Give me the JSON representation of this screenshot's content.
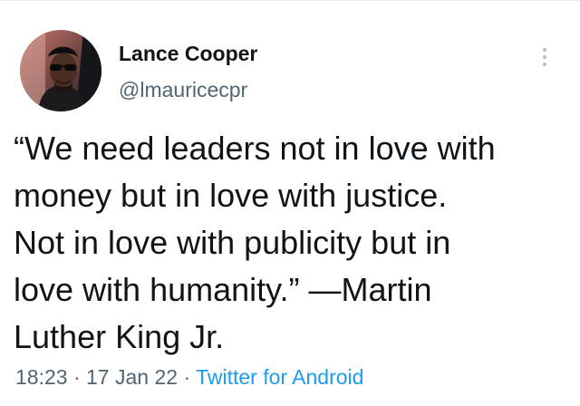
{
  "author": {
    "display_name": "Lance Cooper",
    "handle": "@lmauricecpr",
    "avatar_icon": "profile-photo-man-sunglasses"
  },
  "menu": {
    "icon": "more-vertical-icon"
  },
  "tweet": {
    "lines": [
      "“We need leaders not in love with",
      "money but in love with justice.",
      "Not in love with publicity but in",
      "love with humanity.” —Martin",
      "Luther King Jr."
    ]
  },
  "meta": {
    "time": "18:23",
    "separator": "·",
    "date": "17 Jan 22",
    "source": "Twitter for Android"
  },
  "colors": {
    "text": "#0f1419",
    "secondary": "#536471",
    "link": "#1d9bf0"
  }
}
